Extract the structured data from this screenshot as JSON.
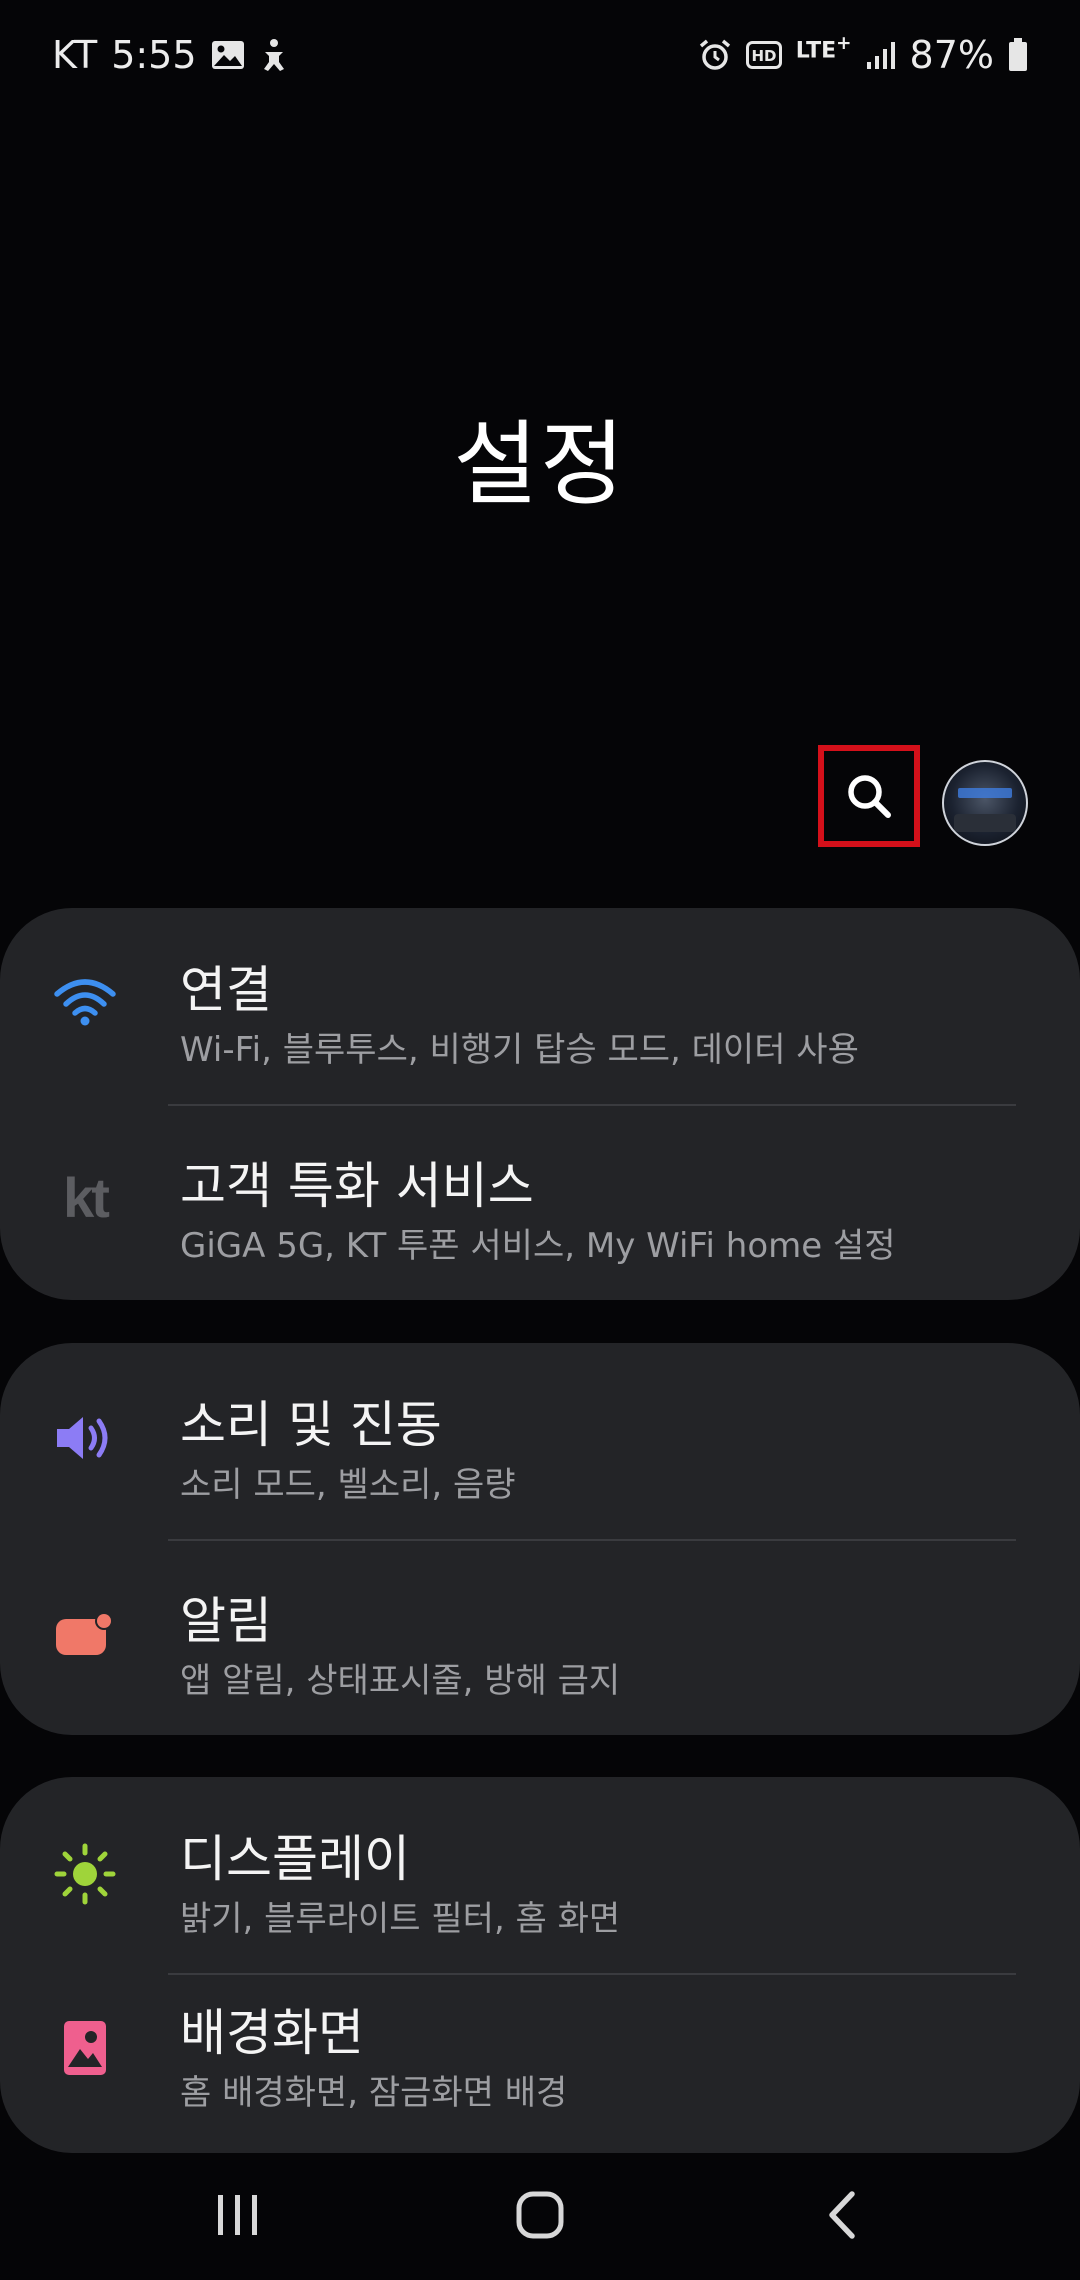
{
  "status_bar": {
    "carrier": "KT",
    "time": "5:55",
    "network": "LTE",
    "network_sup": "+",
    "hd_label": "HD",
    "battery": "87%"
  },
  "header": {
    "title": "설정"
  },
  "groups": [
    {
      "items": [
        {
          "title": "연결",
          "subtitle": "Wi-Fi, 블루투스, 비행기 탑승 모드, 데이터 사용",
          "icon": "wifi-icon"
        },
        {
          "title": "고객 특화 서비스",
          "subtitle": "GiGA 5G, KT 투폰 서비스, My WiFi home 설정",
          "icon": "kt-logo-icon",
          "icon_text": "kt"
        }
      ]
    },
    {
      "items": [
        {
          "title": "소리 및 진동",
          "subtitle": "소리 모드, 벨소리, 음량",
          "icon": "volume-icon"
        },
        {
          "title": "알림",
          "subtitle": "앱 알림, 상태표시줄, 방해 금지",
          "icon": "notification-icon"
        }
      ]
    },
    {
      "items": [
        {
          "title": "디스플레이",
          "subtitle": "밝기, 블루라이트 필터, 홈 화면",
          "icon": "brightness-icon"
        },
        {
          "title": "배경화면",
          "subtitle": "홈 배경화면, 잠금화면 배경",
          "icon": "wallpaper-icon"
        }
      ]
    }
  ],
  "colors": {
    "background": "#050507",
    "card": "#232427",
    "wifi_icon": "#3d8ff0",
    "volume_icon": "#8c7cf5",
    "notification_icon": "#f07868",
    "brightness_icon": "#9fd43a",
    "wallpaper_icon": "#ef5f8e",
    "highlight_box": "#d4101a"
  }
}
